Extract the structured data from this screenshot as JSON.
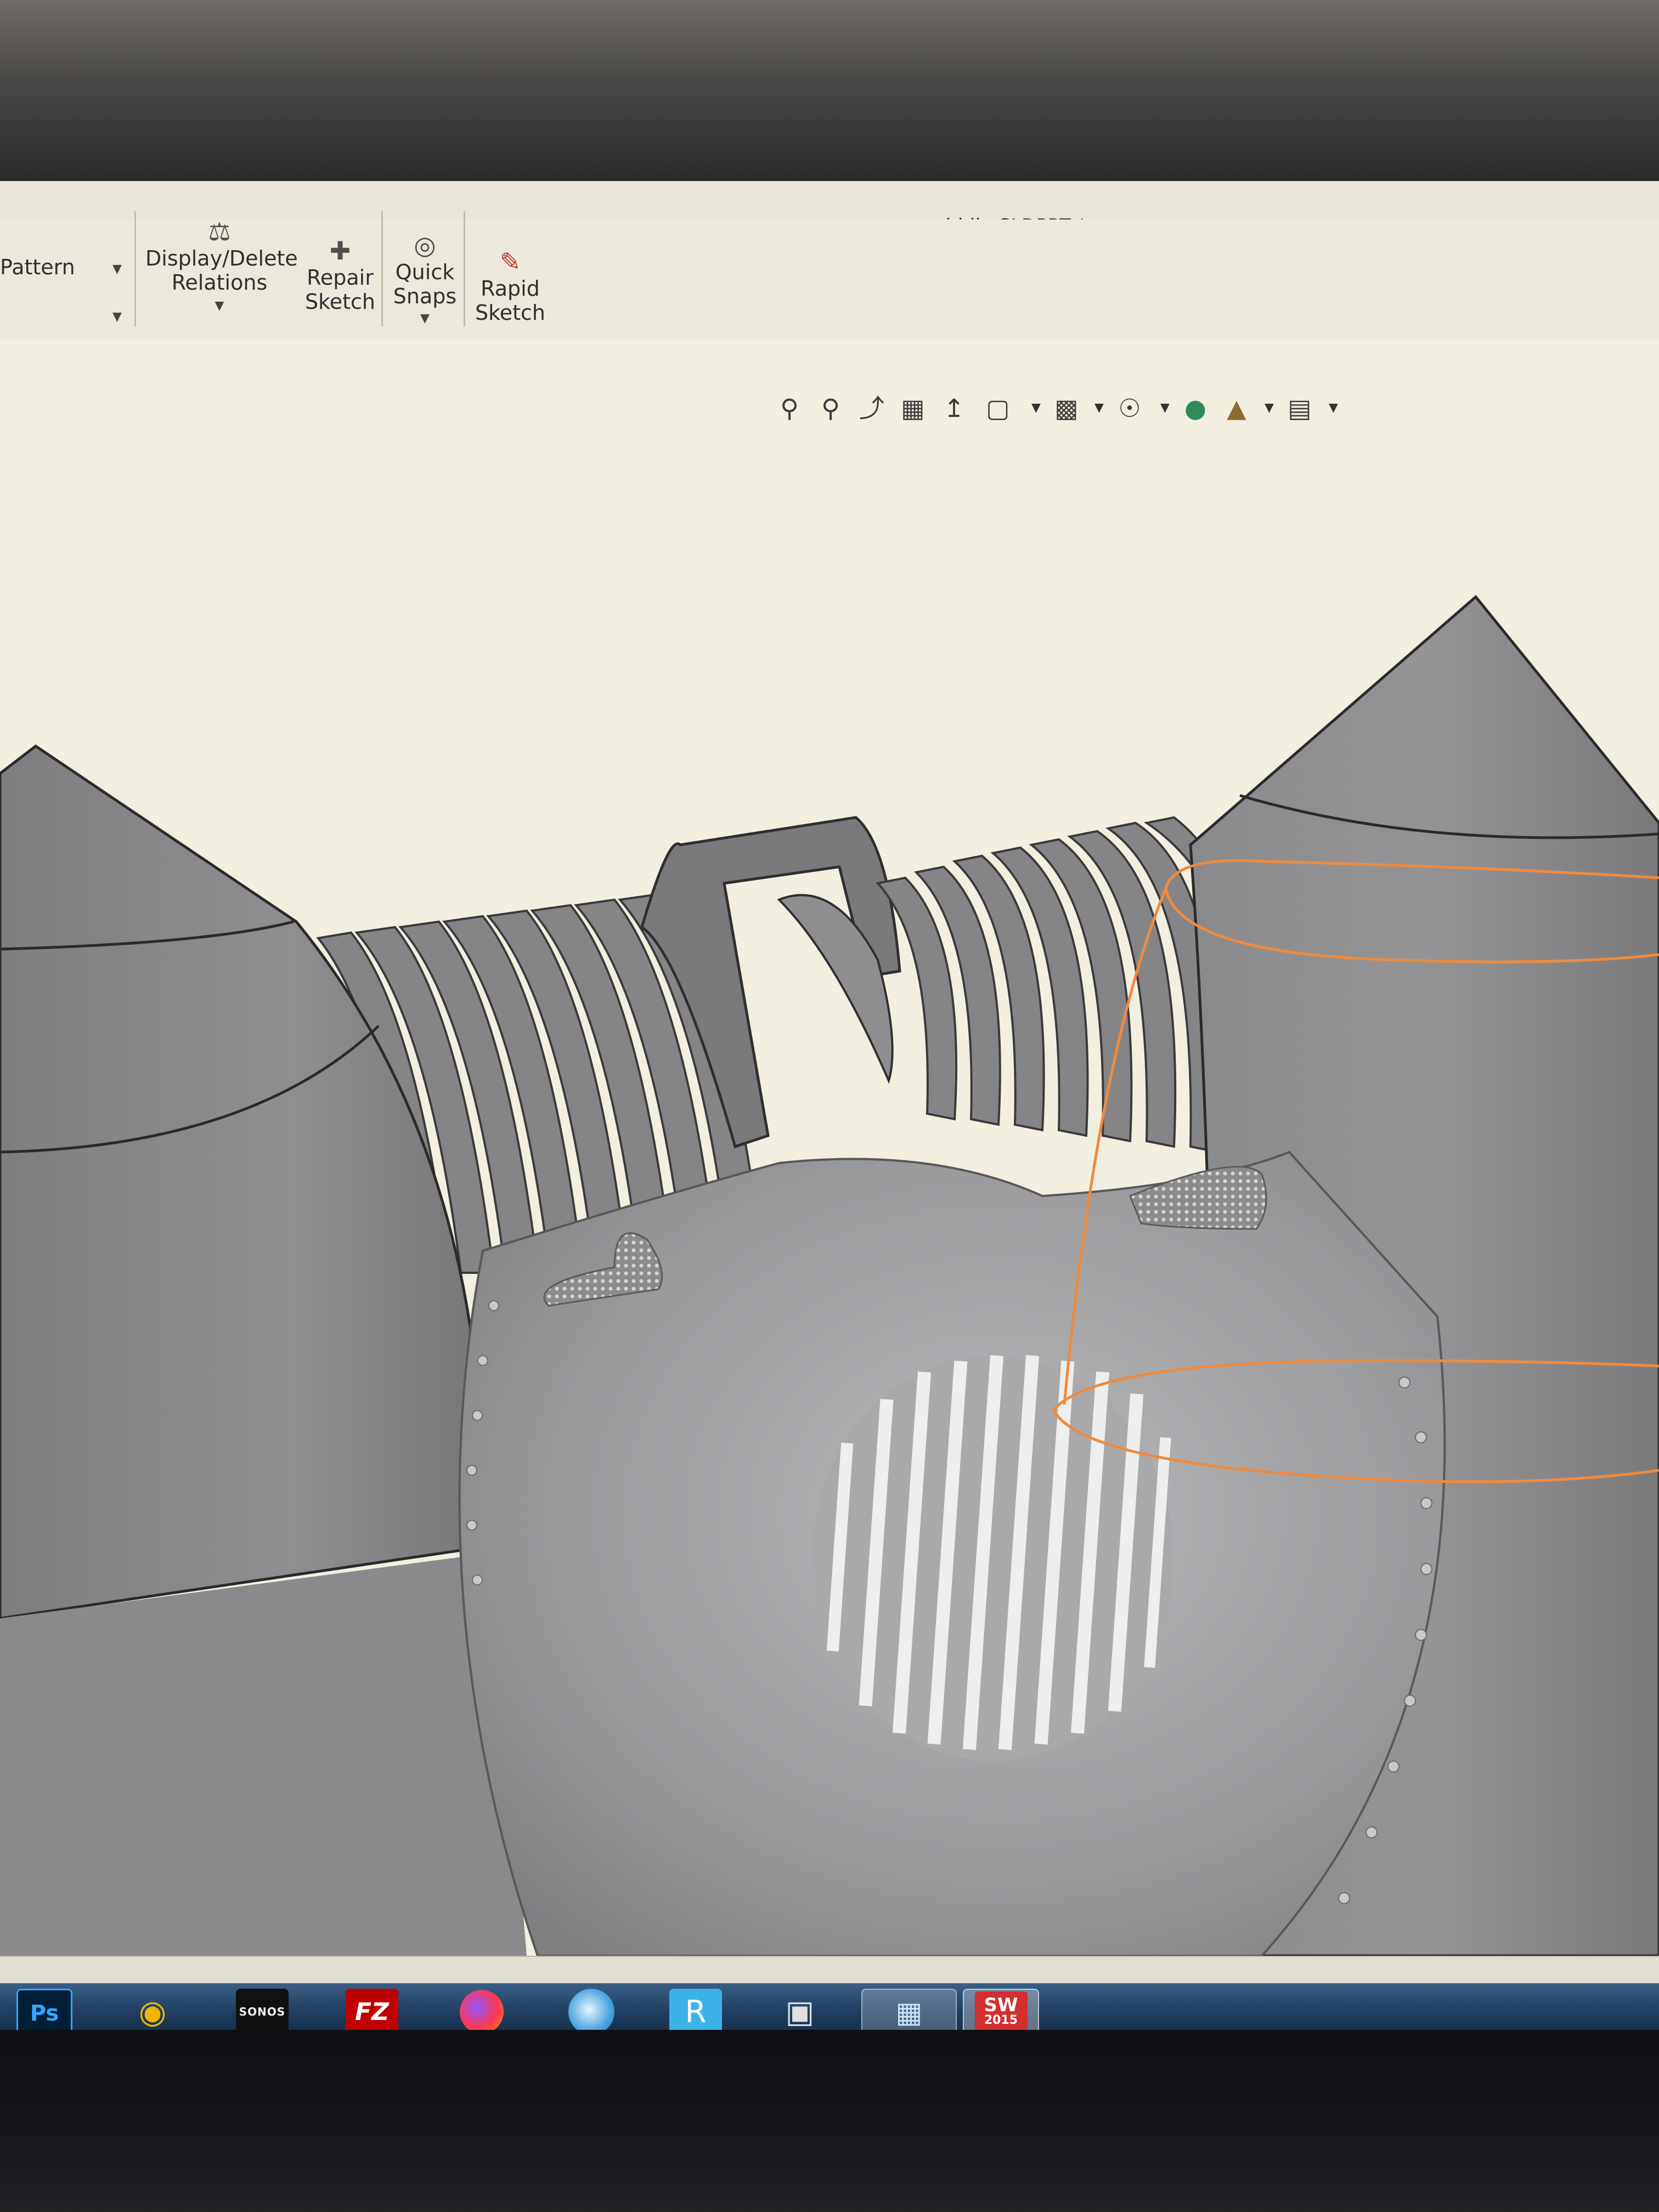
{
  "window": {
    "title": "middle.SLDPRT *"
  },
  "ribbon": {
    "pattern_label": "Pattern",
    "display_delete_relations": {
      "line1": "Display/Delete",
      "line2": "Relations"
    },
    "repair_sketch": {
      "line1": "Repair",
      "line2": "Sketch"
    },
    "quick_snaps": {
      "line1": "Quick",
      "line2": "Snaps"
    },
    "rapid_sketch": {
      "line1": "Rapid",
      "line2": "Sketch"
    }
  },
  "heads_up_toolbar": {
    "icons": [
      "zoom-to-fit-icon",
      "zoom-to-area-icon",
      "previous-view-icon",
      "section-view-icon",
      "dynamic-annotation-icon",
      "view-orientation-icon",
      "display-style-icon",
      "hide-show-items-icon",
      "edit-appearance-icon",
      "apply-scene-icon",
      "view-settings-icon"
    ]
  },
  "taskbar": {
    "apps": [
      {
        "name": "Photoshop",
        "label": "Ps",
        "color": "#31a8ff"
      },
      {
        "name": "Headphones app",
        "label": "",
        "color": "#f2b400"
      },
      {
        "name": "Sonos",
        "label": "SONOS",
        "color": "#111111"
      },
      {
        "name": "FileZilla",
        "label": "FZ",
        "color": "#bf0000"
      },
      {
        "name": "Firefox",
        "label": "",
        "color": "#ff7139"
      },
      {
        "name": "Internet browser",
        "label": "",
        "color": "#4aa3e0"
      },
      {
        "name": "Remote app",
        "label": "R",
        "color": "#3bb3e8"
      },
      {
        "name": "Camera app",
        "label": "",
        "color": "#cfcfcf"
      },
      {
        "name": "Remote desktop",
        "label": "",
        "color": "#7fb2e5"
      },
      {
        "name": "SolidWorks 2015",
        "label": "SW",
        "year": "2015",
        "color": "#d32f2f"
      }
    ]
  },
  "colors": {
    "viewport_bg": "#f3efe0",
    "model_gray": "#8a8a8c",
    "selection_orange": "#f08a3c"
  }
}
